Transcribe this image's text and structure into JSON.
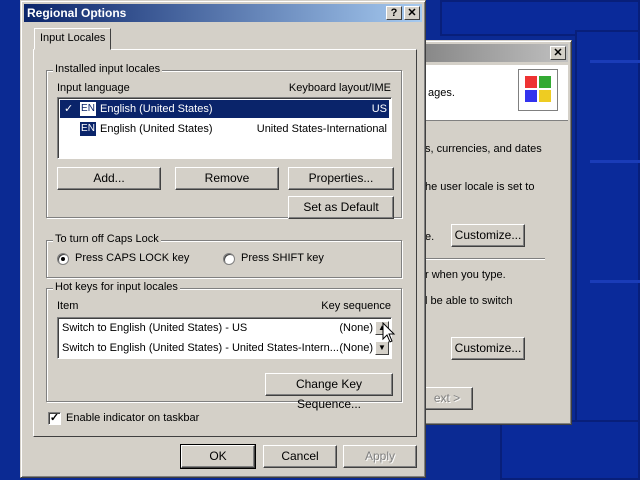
{
  "dialog": {
    "title": "Regional Options",
    "help_btn": "?",
    "close_btn": "✕",
    "tab_label": "Input Locales",
    "installed": {
      "label": "Installed input locales",
      "col_language": "Input language",
      "col_layout": "Keyboard layout/IME",
      "rows": [
        {
          "check": "✓",
          "badge": "EN",
          "language": "English (United States)",
          "layout": "US"
        },
        {
          "check": "",
          "badge": "EN",
          "language": "English (United States)",
          "layout": "United States-International"
        }
      ],
      "add": "Add...",
      "remove": "Remove",
      "properties": "Properties...",
      "set_default": "Set as Default"
    },
    "caps": {
      "label": "To turn off Caps Lock",
      "option1": "Press CAPS LOCK key",
      "option2": "Press SHIFT key"
    },
    "hotkeys": {
      "label": "Hot keys for input locales",
      "col_item": "Item",
      "col_seq": "Key sequence",
      "rows": [
        {
          "item": "Switch to English (United States) - US",
          "seq": "(None)"
        },
        {
          "item": "Switch to English (United States) - United States-Intern...",
          "seq": "(None)"
        }
      ],
      "change": "Change Key Sequence..."
    },
    "indicator": "Enable indicator on taskbar",
    "ok": "OK",
    "cancel": "Cancel",
    "apply": "Apply"
  },
  "bg_window": {
    "close_btn": "✕",
    "text1": "ages.",
    "text2": "s, currencies, and dates",
    "text3": "he user locale is set to",
    "text4": "e.",
    "customize1": "Customize...",
    "text5": "r when you type.",
    "text6": "l be able to switch",
    "customize2": "Customize...",
    "next": "ext >"
  }
}
